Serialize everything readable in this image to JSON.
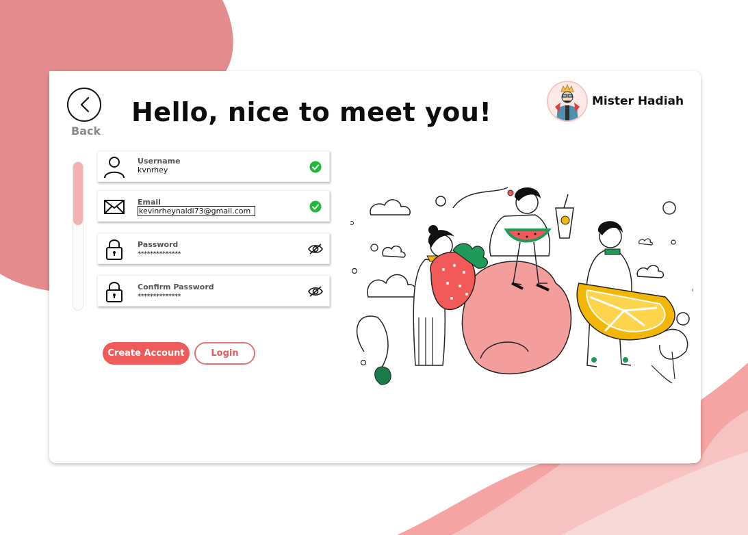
{
  "header": {
    "back_label": "Back",
    "title": "Hello, nice to meet you!"
  },
  "profile": {
    "name": "Mister Hadiah",
    "avatar_icon": "king-avatar-icon"
  },
  "form": {
    "fields": [
      {
        "label": "Username",
        "value": "kvnrhey",
        "icon": "user-icon",
        "status": "check-icon"
      },
      {
        "label": "Email",
        "value": "kevinrheynaldi73@gmail.com",
        "icon": "envelope-icon",
        "status": "check-icon"
      },
      {
        "label": "Password",
        "value": "**************",
        "icon": "lock-icon",
        "status": "eye-off-icon"
      },
      {
        "label": "Confirm Password",
        "value": "**************",
        "icon": "lock-icon",
        "status": "eye-off-icon"
      }
    ]
  },
  "actions": {
    "create_label": "Create Account",
    "login_label": "Login"
  },
  "colors": {
    "accent": "#ef5a5a",
    "check": "#1fb83a",
    "blob": "#e48b8d",
    "wave": "#f7b5b2"
  }
}
